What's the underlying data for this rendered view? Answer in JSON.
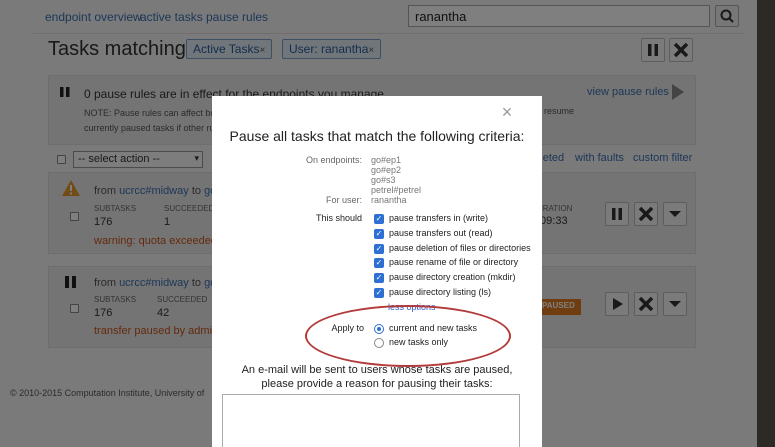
{
  "nav": {
    "links": [
      "endpoint overview",
      "active tasks",
      "pause rules"
    ],
    "search_value": "ranantha"
  },
  "heading": {
    "title": "Tasks matching:",
    "filters": [
      "Active Tasks",
      "User: ranantha"
    ]
  },
  "pause_banner": {
    "title": "0 pause rules are in effect for the endpoints you manage.",
    "note_line1": "NOTE: Pause rules can affect both",
    "note_line2": "currently paused tasks if other rules",
    "note_right": "resume",
    "view_link": "view pause rules"
  },
  "list_toolbar": {
    "select_action": "-- select action --",
    "link_completed": "mpleted",
    "link_faults": "with faults",
    "link_custom": "custom filter"
  },
  "tasks": [
    {
      "from_prefix": "from",
      "from_ep": "ucrcc#midway",
      "to_word": "to",
      "to_ep": "go#",
      "subtasks_label": "SUBTASKS",
      "subtasks": "176",
      "succeeded_label": "SUCCEEDED",
      "succeeded": "1",
      "duration_label": "URATION",
      "duration": ":09:33",
      "message": "warning: quota exceeded;"
    },
    {
      "from_prefix": "from",
      "from_ep": "ucrcc#midway",
      "to_word": "to",
      "to_ep": "go#",
      "subtasks_label": "SUBTASKS",
      "subtasks": "176",
      "succeeded_label": "SUCCEEDED",
      "succeeded": "42",
      "status_badge": "PAUSED",
      "message": "transfer paused by admin -"
    }
  ],
  "footer": {
    "copyright": "© 2010-2015 Computation Institute, University of"
  },
  "modal": {
    "title": "Pause all tasks that match the following criteria:",
    "endpoints_label": "On endpoints:",
    "endpoints": [
      "go#ep1",
      "go#ep2",
      "go#s3",
      "petrel#petrel"
    ],
    "user_label": "For user:",
    "user": "ranantha",
    "should_label": "This should",
    "options": [
      "pause transfers in (write)",
      "pause transfers out (read)",
      "pause deletion of files or directories",
      "pause rename of file or directory",
      "pause directory creation (mkdir)",
      "pause directory listing (ls)"
    ],
    "less_options": "less options",
    "apply_label": "Apply to",
    "apply_options": [
      "current and new tasks",
      "new tasks only"
    ],
    "apply_selected": 0,
    "email_line1": "An e-mail will be sent to users whose tasks are paused,",
    "email_line2": "please provide a reason for pausing their tasks:",
    "close_icon": "×"
  },
  "colors": {
    "link": "#3a6fb0",
    "warning": "#c9541a",
    "paused_badge": "#e07b22",
    "checkbox": "#2e6fd3",
    "highlight": "#b23a3a"
  }
}
